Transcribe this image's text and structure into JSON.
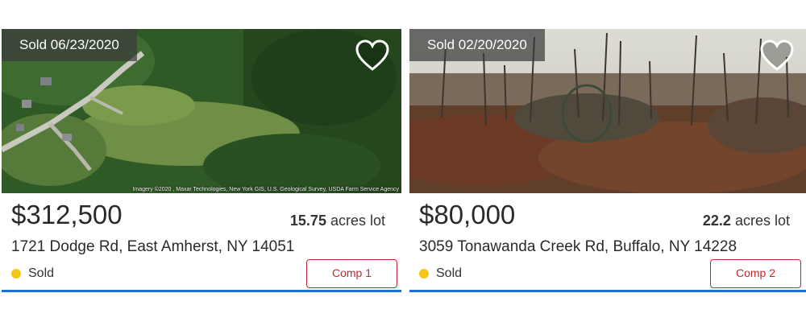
{
  "colors": {
    "accent_underline": "#1a6fdf",
    "sold_dot": "#f5c518",
    "comp_button": "#c4282d"
  },
  "listings": [
    {
      "sold_tag": "Sold 06/23/2020",
      "imagery_credit": "Imagery ©2020 , Maxar Technologies, New York GIS, U.S. Geological Survey, USDA Farm Service Agency",
      "price": "$312,500",
      "lot_size": "15.75",
      "lot_unit": "acres lot",
      "address": "1721 Dodge Rd, East Amherst, NY 14051",
      "status": "Sold",
      "comp_label": "Comp 1",
      "icons": {
        "favorite": "heart-outline-icon",
        "status": "status-dot-icon"
      }
    },
    {
      "sold_tag": "Sold 02/20/2020",
      "price": "$80,000",
      "lot_size": "22.2",
      "lot_unit": "acres lot",
      "address": "3059 Tonawanda Creek Rd, Buffalo, NY 14228",
      "status": "Sold",
      "comp_label": "Comp 2",
      "icons": {
        "favorite": "heart-outline-icon",
        "status": "status-dot-icon"
      }
    }
  ]
}
